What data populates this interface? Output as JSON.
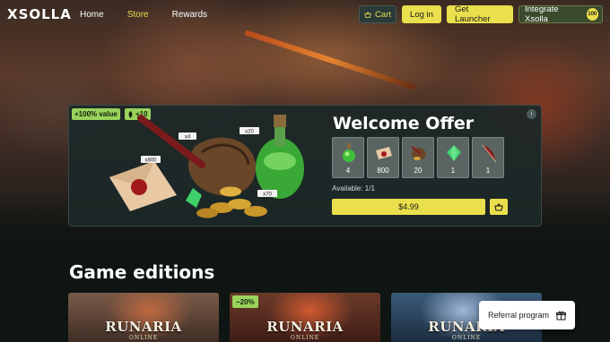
{
  "nav": {
    "logo": "XSOLLA",
    "links": [
      {
        "label": "Home",
        "active": false
      },
      {
        "label": "Store",
        "active": true
      },
      {
        "label": "Rewards",
        "active": false
      }
    ],
    "cart_label": "Cart",
    "login_label": "Log in",
    "launcher_label": "Get Launcher",
    "integrate_label": "Integrate Xsolla",
    "integrate_badge": "100"
  },
  "offer": {
    "value_tag": "+100% value",
    "bonus_tag": "+10",
    "title": "Welcome Offer",
    "items": [
      {
        "icon": "potion-icon",
        "qty": "4"
      },
      {
        "icon": "letter-icon",
        "qty": "800"
      },
      {
        "icon": "treasure-bag-icon",
        "qty": "20"
      },
      {
        "icon": "gem-icon",
        "qty": "1"
      },
      {
        "icon": "quill-icon",
        "qty": "1"
      }
    ],
    "available": "Available: 1/1",
    "price": "$4.99",
    "pack_labels": [
      "x4",
      "x800",
      "x20",
      "x70"
    ]
  },
  "editions": {
    "title": "Game editions",
    "cards": [
      {
        "logo": "RUNARIA",
        "sub": "ONLINE",
        "discount": ""
      },
      {
        "logo": "RUNARIA",
        "sub": "ONLINE",
        "discount": "−20%"
      },
      {
        "logo": "RUNARIA",
        "sub": "ONLINE",
        "discount": ""
      }
    ]
  },
  "referral_label": "Referral program",
  "colors": {
    "accent": "#eadf4c",
    "tag": "#9ad35a",
    "panel": "#1c2828"
  }
}
